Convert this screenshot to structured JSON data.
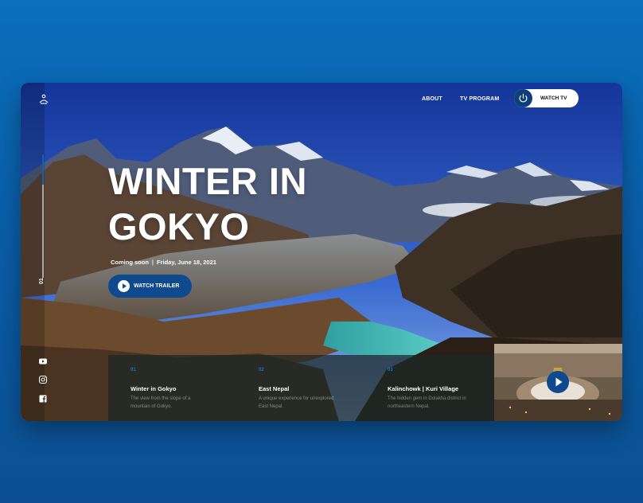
{
  "nav": {
    "logo_icon": "hiker-icon",
    "about_label": "ABOUT",
    "tv_program_label": "TV PROGRAM",
    "watch_tv_label": "WATCH TV",
    "watch_tv_icon": "power-icon"
  },
  "hero": {
    "title_line1": "WINTER IN",
    "title_line2": "GOKYO",
    "coming_soon": "Coming soon",
    "separator": "|",
    "date": "Friday, June 18, 2021",
    "trailer_label": "WATCH TRAILER",
    "slide_number": "01"
  },
  "social": [
    {
      "icon": "youtube-icon"
    },
    {
      "icon": "instagram-icon"
    },
    {
      "icon": "facebook-icon"
    }
  ],
  "episodes": [
    {
      "num": "01",
      "title": "Winter in Gokyo",
      "desc": "The view from the slope of a mountain of Gokyo."
    },
    {
      "num": "02",
      "title": "East Nepal",
      "desc": "A unique experience for unexplored East Nepal."
    },
    {
      "num": "03",
      "title": "Kalinchowk | Kuri Village",
      "desc": "The hidden gem in Dolakha district in northeastern Nepal."
    }
  ],
  "colors": {
    "page_background": "#0a5ea8",
    "accent": "#0f4a8e",
    "episode_number": "#1a6fd0"
  }
}
